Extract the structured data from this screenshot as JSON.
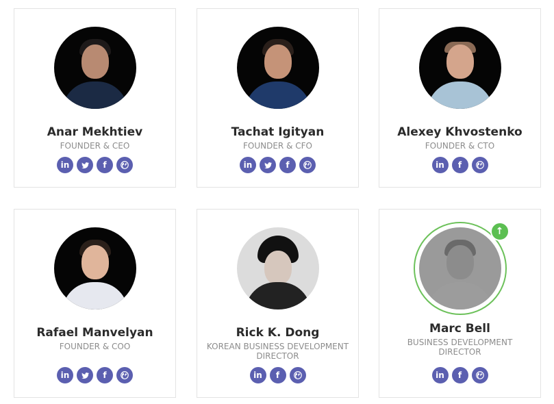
{
  "team": [
    {
      "name": "Anar Mekhtiev",
      "role": "FOUNDER & CEO"
    },
    {
      "name": "Tachat Igityan",
      "role": "FOUNDER & CFO"
    },
    {
      "name": "Alexey Khvostenko",
      "role": "FOUNDER & CTO"
    },
    {
      "name": "Rafael Manvelyan",
      "role": "FOUNDER & COO"
    },
    {
      "name": "Rick K. Dong",
      "role": "KOREAN BUSINESS DEVELOPMENT DIRECTOR"
    },
    {
      "name": "Marc Bell",
      "role": "BUSINESS DEVELOPMENT DIRECTOR"
    }
  ],
  "social_icons": {
    "linkedin": "in",
    "facebook": "f"
  },
  "colors": {
    "social_bg": "#5b5fb0",
    "highlight_ring": "#6cc15a",
    "name_text": "#2b2b2b",
    "role_text": "#8c8c8c"
  }
}
